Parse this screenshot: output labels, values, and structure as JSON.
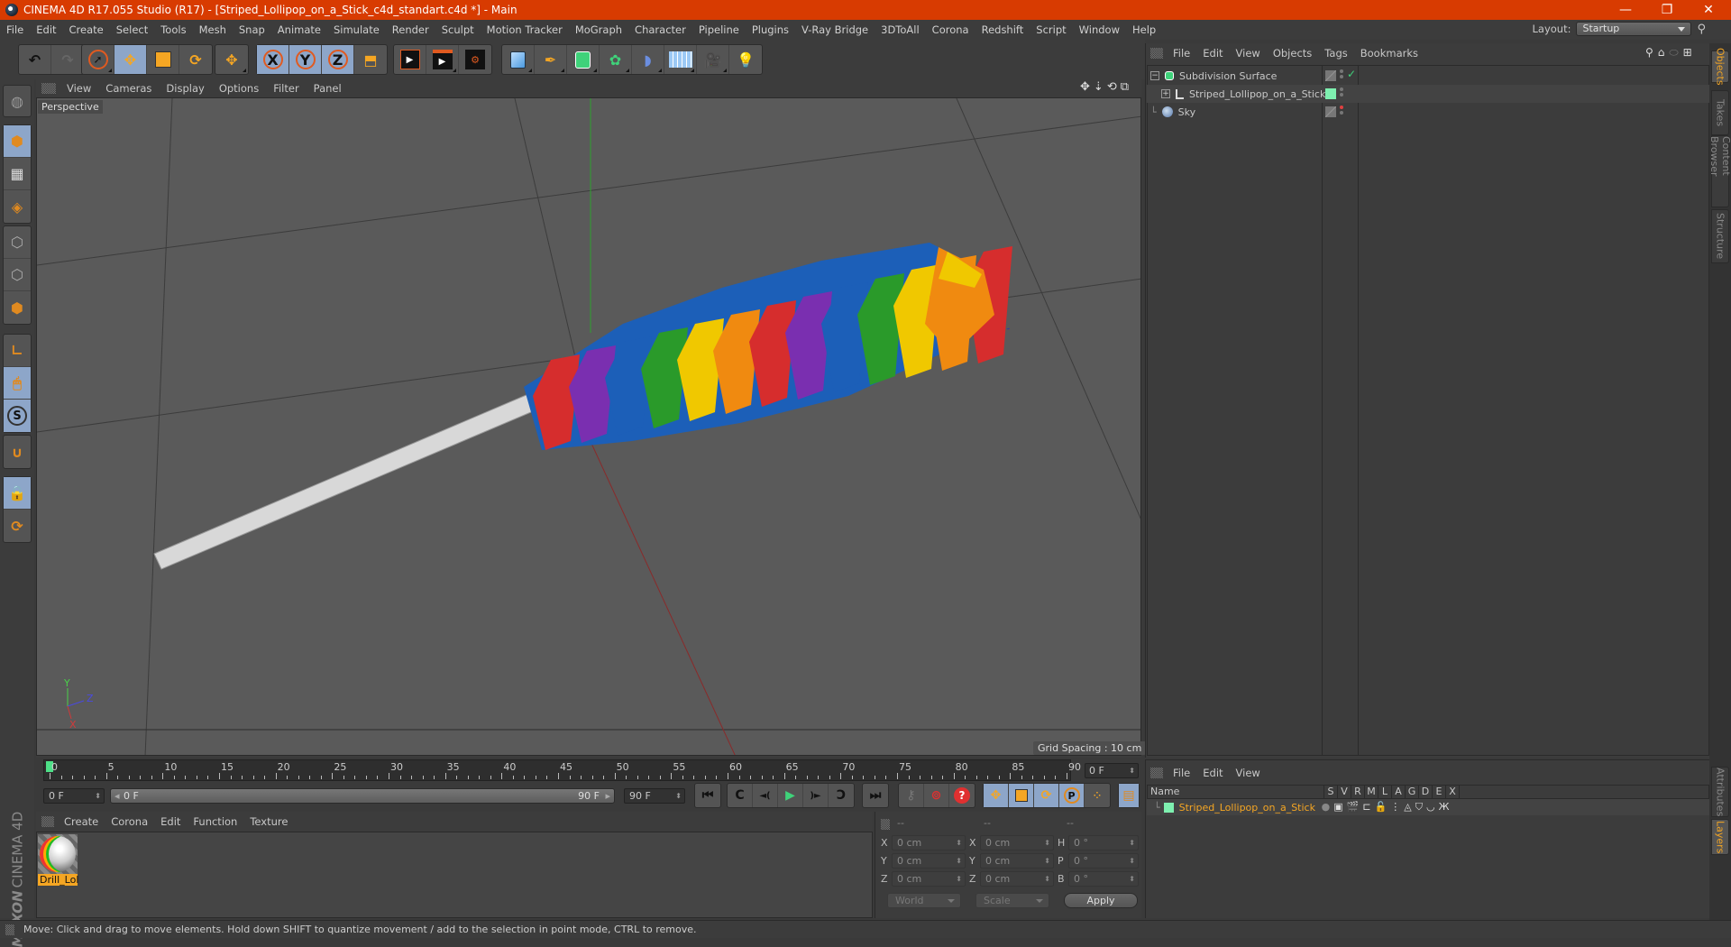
{
  "window": {
    "title": "CINEMA 4D R17.055 Studio (R17) - [Striped_Lollipop_on_a_Stick_c4d_standart.c4d *] - Main",
    "controls": {
      "minimize": "—",
      "restore": "❐",
      "close": "✕"
    }
  },
  "menubar": [
    "File",
    "Edit",
    "Create",
    "Select",
    "Tools",
    "Mesh",
    "Snap",
    "Animate",
    "Simulate",
    "Render",
    "Sculpt",
    "Motion Tracker",
    "MoGraph",
    "Character",
    "Pipeline",
    "Plugins",
    "V-Ray Bridge",
    "3DToAll",
    "Corona",
    "Redshift",
    "Script",
    "Window",
    "Help"
  ],
  "layout": {
    "label": "Layout:",
    "value": "Startup"
  },
  "toolbar": {
    "groups": [
      [
        "undo-icon",
        "redo-icon"
      ],
      [
        "select-icon",
        "move-icon",
        "scale-icon",
        "rotate-icon"
      ],
      [
        "move-last-icon"
      ],
      [
        "x-axis-icon",
        "y-axis-icon",
        "z-axis-icon",
        "coordinate-system-icon"
      ],
      [
        "render-view-icon",
        "render-picture-viewer-icon",
        "render-settings-icon"
      ],
      [
        "cube-icon",
        "pen-icon",
        "subdivision-icon",
        "cloner-icon",
        "deformer-icon",
        "floor-icon",
        "camera-icon",
        "light-icon"
      ]
    ],
    "axis_labels": {
      "x": "X",
      "y": "Y",
      "z": "Z"
    }
  },
  "left_tools": [
    "model-mode-icon",
    "texture-mode-icon",
    "workplane-mode-icon",
    "points-mode-icon",
    "edges-mode-icon",
    "polygons-mode-icon",
    "axis-icon",
    "tweak-icon",
    "snap-icon",
    "magnet-icon",
    "workplane-lock-icon",
    "workplane-sync-icon"
  ],
  "viewport": {
    "menu": [
      "View",
      "Cameras",
      "Display",
      "Options",
      "Filter",
      "Panel"
    ],
    "label": "Perspective",
    "grid_spacing": "Grid Spacing : 10 cm",
    "axis": {
      "x": "X",
      "y": "Y",
      "z": "Z"
    },
    "stripe_colors": [
      "#d62d2d",
      "#7a2fb0",
      "#1c5fb8",
      "#2a9a2a",
      "#f0c800",
      "#f08a10"
    ]
  },
  "timeline": {
    "ticks": [
      0,
      5,
      10,
      15,
      20,
      25,
      30,
      35,
      40,
      45,
      50,
      55,
      60,
      65,
      70,
      75,
      80,
      85,
      90
    ],
    "current_frame": "0 F",
    "start_field": "0 F",
    "range_start": "0 F",
    "range_end": "90 F",
    "end_field": "90 F"
  },
  "playback": {
    "goto_start": "⏮",
    "prev_key": "◄(",
    "play": "▶",
    "next_key": ")►",
    "goto_end": "⏭"
  },
  "material_panel": {
    "menu": [
      "Create",
      "Corona",
      "Edit",
      "Function",
      "Texture"
    ],
    "materials": [
      {
        "name": "Drill_Lol"
      }
    ],
    "logo": {
      "brand": "MAXON",
      "product": "CINEMA 4D"
    }
  },
  "coords": {
    "headers": [
      "--",
      "--",
      "--"
    ],
    "rows": [
      {
        "l1": "X",
        "v1": "0 cm",
        "l2": "X",
        "v2": "0 cm",
        "l3": "H",
        "v3": "0 °"
      },
      {
        "l1": "Y",
        "v1": "0 cm",
        "l2": "Y",
        "v2": "0 cm",
        "l3": "P",
        "v3": "0 °"
      },
      {
        "l1": "Z",
        "v1": "0 cm",
        "l2": "Z",
        "v2": "0 cm",
        "l3": "B",
        "v3": "0 °"
      }
    ],
    "space": "World",
    "mode": "Scale",
    "apply": "Apply"
  },
  "status": "Move: Click and drag to move elements. Hold down SHIFT to quantize movement / add to the selection in point mode, CTRL to remove.",
  "object_manager": {
    "menu": [
      "File",
      "Edit",
      "View",
      "Objects",
      "Tags",
      "Bookmarks"
    ],
    "objects": [
      {
        "name": "Subdivision Surface",
        "icon": "subdivision-icon",
        "tag": "check",
        "expanded": true
      },
      {
        "name": "Striped_Lollipop_on_a_Stick",
        "icon": "null-object-icon",
        "tag": "layer",
        "layer_color": "#7ef0b0"
      },
      {
        "name": "Sky",
        "icon": "sky-icon",
        "tag": "none"
      }
    ]
  },
  "layers_manager": {
    "menu": [
      "File",
      "Edit",
      "View"
    ],
    "columns": [
      "Name",
      "S",
      "V",
      "R",
      "M",
      "L",
      "A",
      "G",
      "D",
      "E",
      "X"
    ],
    "layers": [
      {
        "name": "Striped_Lollipop_on_a_Stick",
        "color": "#7ef0b0"
      }
    ]
  },
  "side_tabs_top": [
    "Objects",
    "Takes",
    "Content Browser",
    "Structure"
  ],
  "side_tabs_bottom": [
    "Attributes",
    "Layers"
  ]
}
